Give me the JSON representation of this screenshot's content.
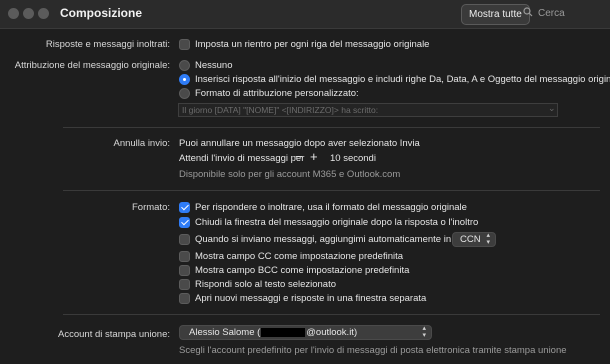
{
  "window": {
    "title": "Composizione",
    "show_all": "Mostra tutte",
    "search_placeholder": "Cerca"
  },
  "reply": {
    "label": "Risposte e messaggi inoltrati:",
    "indent_option": "Imposta un rientro per ogni riga del messaggio originale",
    "indent_checked": false
  },
  "attribution": {
    "label": "Attribuzione del messaggio originale:",
    "options": [
      "Nessuno",
      "Inserisci risposta all'inizio del messaggio e includi righe Da, Data, A e Oggetto del messaggio originale",
      "Formato di attribuzione personalizzato:"
    ],
    "selected_index": 1,
    "custom_format_placeholder": "Il giorno [DATA] \"[NOME]\" <[INDIRIZZO]> ha scritto:"
  },
  "undo_send": {
    "label": "Annulla invio:",
    "description": "Puoi annullare un messaggio dopo aver selezionato Invia",
    "delay_label": "Attendi l'invio di messaggi per",
    "minus": "−",
    "plus": "+",
    "value": "10 secondi",
    "note": "Disponibile solo per gli account M365 e Outlook.com"
  },
  "format": {
    "label": "Formato:",
    "options": [
      {
        "text": "Per rispondere o inoltrare, usa il formato del messaggio originale",
        "checked": true
      },
      {
        "text": "Chiudi la finestra del messaggio originale dopo la risposta o l'inoltro",
        "checked": true
      },
      {
        "text": "Quando si inviano messaggi, aggiungimi automaticamente in Cc o Ccn",
        "checked": false
      },
      {
        "text": "Mostra campo CC come impostazione predefinita",
        "checked": false
      },
      {
        "text": "Mostra campo BCC come impostazione predefinita",
        "checked": false
      },
      {
        "text": "Rispondi solo al testo selezionato",
        "checked": false
      },
      {
        "text": "Apri nuovi messaggi e risposte in una finestra separata",
        "checked": false
      }
    ],
    "cc_popup_value": "CCN"
  },
  "merge": {
    "label": "Account di stampa unione:",
    "account_name": "Alessio Salome (",
    "account_suffix": "@outlook.it)",
    "note": "Scegli l'account predefinito per l'invio di messaggi di posta elettronica tramite stampa unione"
  }
}
